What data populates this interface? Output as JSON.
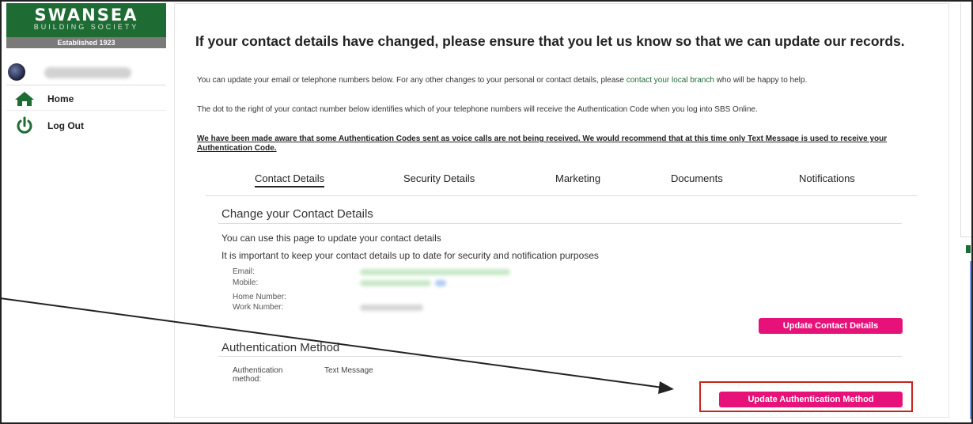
{
  "brand": {
    "name": "SWANSEA",
    "subtitle": "BUILDING SOCIETY",
    "established": "Established 1923",
    "color": "#1e6b34"
  },
  "sidebar": {
    "items": [
      {
        "label": "Home",
        "icon": "home-icon"
      },
      {
        "label": "Log Out",
        "icon": "power-icon"
      }
    ]
  },
  "main": {
    "headline": "If your contact details have changed, please ensure that you let us know so that we can update our records.",
    "para1_before": "You can update your email or telephone numbers below. For any other changes to your personal or contact details, please ",
    "para1_link": "contact your local branch ",
    "para1_after": "who will be happy to help.",
    "para2": "The dot to the right of your contact number below identifies which of your telephone numbers will receive the Authentication Code when you log into SBS Online.",
    "para3": "We have been made aware that some Authentication Codes sent as voice calls are not being received. We would recommend that at this time only Text Message is used to receive your Authentication Code.",
    "tabs": [
      {
        "label": "Contact Details",
        "active": true
      },
      {
        "label": "Security Details",
        "active": false
      },
      {
        "label": "Marketing",
        "active": false
      },
      {
        "label": "Documents",
        "active": false
      },
      {
        "label": "Notifications",
        "active": false
      }
    ],
    "contact_section": {
      "title": "Change your Contact Details",
      "info1": "You can use this page to update your contact details",
      "info2": "It is important to keep your contact details up to date for security and notification purposes",
      "fields": [
        {
          "label": "Email:"
        },
        {
          "label": "Mobile:"
        },
        {
          "label": "Home Number:"
        },
        {
          "label": "Work Number:"
        }
      ],
      "update_button": "Update Contact Details"
    },
    "auth_section": {
      "title": "Authentication Method",
      "label": "Authentication method:",
      "value": "Text Message",
      "update_button": "Update Authentication Method"
    }
  },
  "colors": {
    "accent_button": "#e6127a",
    "highlight_box": "#c8241d"
  }
}
